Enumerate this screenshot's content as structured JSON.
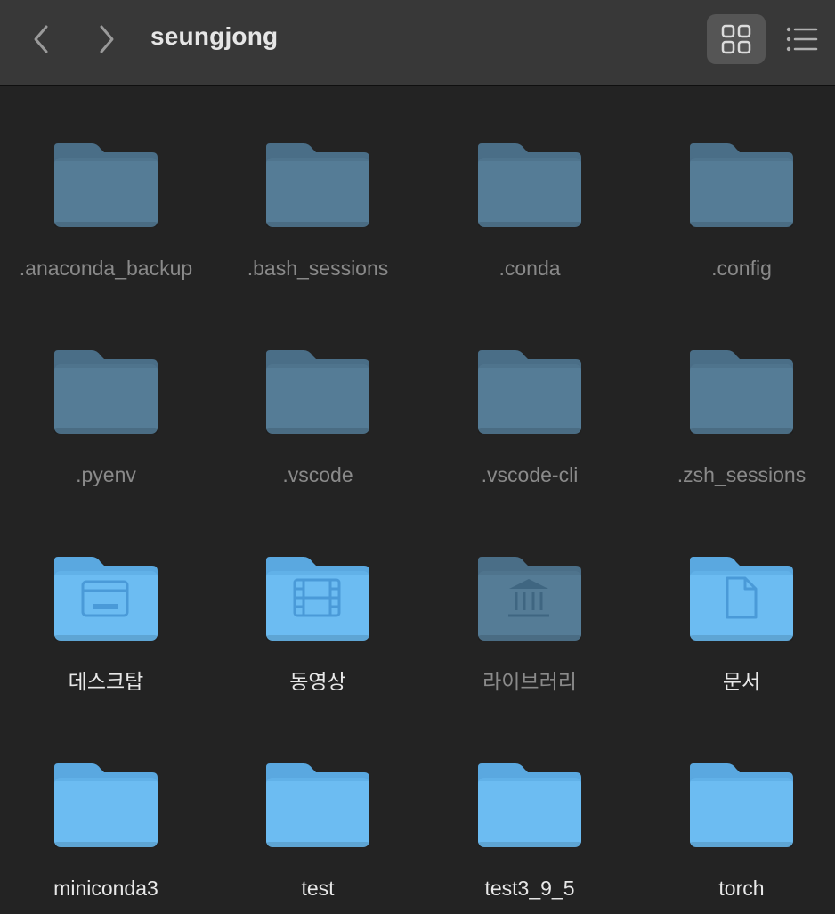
{
  "window": {
    "title": "seungjong",
    "nav": {
      "back_icon": "chevron-left-icon",
      "forward_icon": "chevron-right-icon"
    },
    "view_modes": {
      "grid_icon": "grid-view-icon",
      "list_icon": "list-view-icon",
      "active": "grid"
    }
  },
  "colors": {
    "hidden_folder": "#557c96",
    "folder": "#6cbcf2",
    "folder_glyph": "#4a9ad8"
  },
  "items": [
    {
      "label": ".anaconda_backup",
      "kind": "hidden",
      "glyph": ""
    },
    {
      "label": ".bash_sessions",
      "kind": "hidden",
      "glyph": ""
    },
    {
      "label": ".conda",
      "kind": "hidden",
      "glyph": ""
    },
    {
      "label": ".config",
      "kind": "hidden",
      "glyph": ""
    },
    {
      "label": ".pyenv",
      "kind": "hidden",
      "glyph": ""
    },
    {
      "label": ".vscode",
      "kind": "hidden",
      "glyph": ""
    },
    {
      "label": ".vscode-cli",
      "kind": "hidden",
      "glyph": ""
    },
    {
      "label": ".zsh_sessions",
      "kind": "hidden",
      "glyph": ""
    },
    {
      "label": "데스크탑",
      "kind": "normal",
      "glyph": "desktop-icon"
    },
    {
      "label": "동영상",
      "kind": "normal",
      "glyph": "film-icon"
    },
    {
      "label": "라이브러리",
      "kind": "hidden",
      "glyph": "library-icon"
    },
    {
      "label": "문서",
      "kind": "normal",
      "glyph": "document-icon"
    },
    {
      "label": "miniconda3",
      "kind": "normal",
      "glyph": ""
    },
    {
      "label": "test",
      "kind": "normal",
      "glyph": ""
    },
    {
      "label": "test3_9_5",
      "kind": "normal",
      "glyph": ""
    },
    {
      "label": "torch",
      "kind": "normal",
      "glyph": ""
    }
  ]
}
